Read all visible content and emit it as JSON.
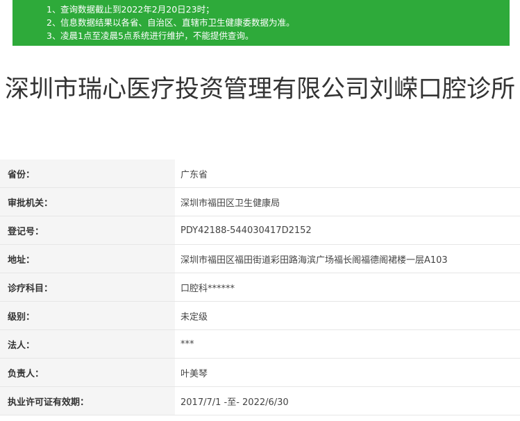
{
  "notice": {
    "items": [
      {
        "num": "1、",
        "text": "查询数据截止到2022年2月20日23时；"
      },
      {
        "num": "2、",
        "text": "信息数据结果以各省、自治区、直辖市卫生健康委数据为准。"
      },
      {
        "num": "3、",
        "text": "凌晨1点至凌晨5点系统进行维护，不能提供查询。"
      }
    ]
  },
  "title": "深圳市瑞心医疗投资管理有限公司刘嵘口腔诊所",
  "info": {
    "rows": [
      {
        "label": "省份：",
        "value": "广东省"
      },
      {
        "label": "审批机关：",
        "value": "深圳市福田区卫生健康局"
      },
      {
        "label": "登记号：",
        "value": "PDY42188-544030417D2152"
      },
      {
        "label": "地址：",
        "value": "深圳市福田区福田街道彩田路海滨广场福长阁福德阁裙楼一层A103"
      },
      {
        "label": "诊疗科目：",
        "value": "口腔科******"
      },
      {
        "label": "级别：",
        "value": "未定级"
      },
      {
        "label": "法人：",
        "value": "***"
      },
      {
        "label": "负责人：",
        "value": "叶美琴"
      },
      {
        "label": "执业许可证有效期：",
        "value": "2017/7/1 -至- 2022/6/30"
      }
    ]
  }
}
